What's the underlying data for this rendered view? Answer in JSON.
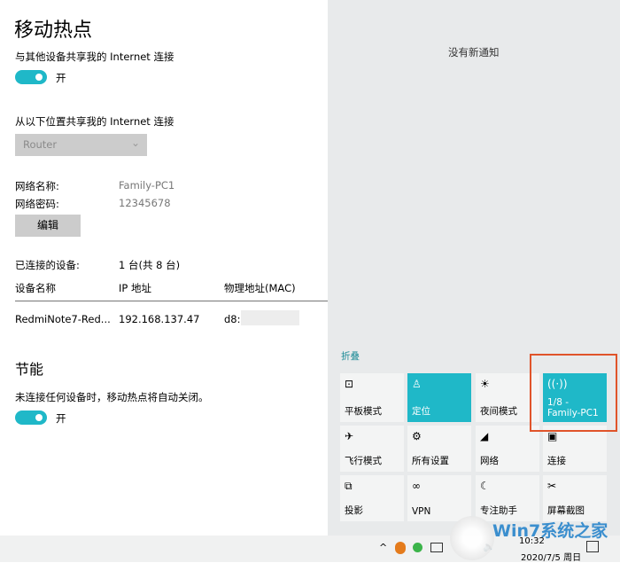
{
  "hotspot": {
    "title": "移动热点",
    "share_label": "与其他设备共享我的 Internet 连接",
    "share_toggle": "开",
    "share_toggle_on": true,
    "from_label": "从以下位置共享我的 Internet 连接",
    "from_value": "Router",
    "network_name_label": "网络名称:",
    "network_name": "Family-PC1",
    "network_password_label": "网络密码:",
    "network_password": "12345678",
    "edit_button": "编辑",
    "connected_label": "已连接的设备:",
    "connected_value": "1 台(共 8 台)",
    "columns": [
      "设备名称",
      "IP 地址",
      "物理地址(MAC)"
    ],
    "rows": [
      {
        "name": "RedmiNote7-Red...",
        "ip": "192.168.137.47",
        "mac": "d8:3"
      }
    ],
    "power_title": "节能",
    "power_label": "未连接任何设备时，移动热点将自动关闭。",
    "power_toggle": "开",
    "power_toggle_on": true
  },
  "action_center": {
    "no_notifications": "没有新通知",
    "collapse": "折叠",
    "accent": "#1fb8c8",
    "highlight_color": "#e0542a",
    "tiles": [
      {
        "label": "平板模式",
        "icon": "tablet-mode-icon",
        "glyph": "⊡",
        "on": false
      },
      {
        "label": "定位",
        "icon": "location-icon",
        "glyph": "♙",
        "on": true
      },
      {
        "label": "夜间模式",
        "icon": "night-light-icon",
        "glyph": "☀",
        "on": false
      },
      {
        "label": "1/8 - Family-PC1",
        "icon": "hotspot-icon",
        "glyph": "((·))",
        "on": true
      },
      {
        "label": "飞行模式",
        "icon": "airplane-icon",
        "glyph": "✈",
        "on": false
      },
      {
        "label": "所有设置",
        "icon": "settings-icon",
        "glyph": "⚙",
        "on": false
      },
      {
        "label": "网络",
        "icon": "network-icon",
        "glyph": "◢",
        "on": false
      },
      {
        "label": "连接",
        "icon": "connect-icon",
        "glyph": "▣",
        "on": false
      },
      {
        "label": "投影",
        "icon": "project-icon",
        "glyph": "⧉",
        "on": false
      },
      {
        "label": "VPN",
        "icon": "vpn-icon",
        "glyph": "∞",
        "on": false
      },
      {
        "label": "专注助手",
        "icon": "focus-assist-icon",
        "glyph": "☾",
        "on": false
      },
      {
        "label": "屏幕截图",
        "icon": "screen-snip-icon",
        "glyph": "✂",
        "on": false
      }
    ]
  },
  "taskbar": {
    "time": "10:32",
    "date": "2020/7/5 周日"
  },
  "watermark": "Win7系统之家 Www.Winwin7.com"
}
